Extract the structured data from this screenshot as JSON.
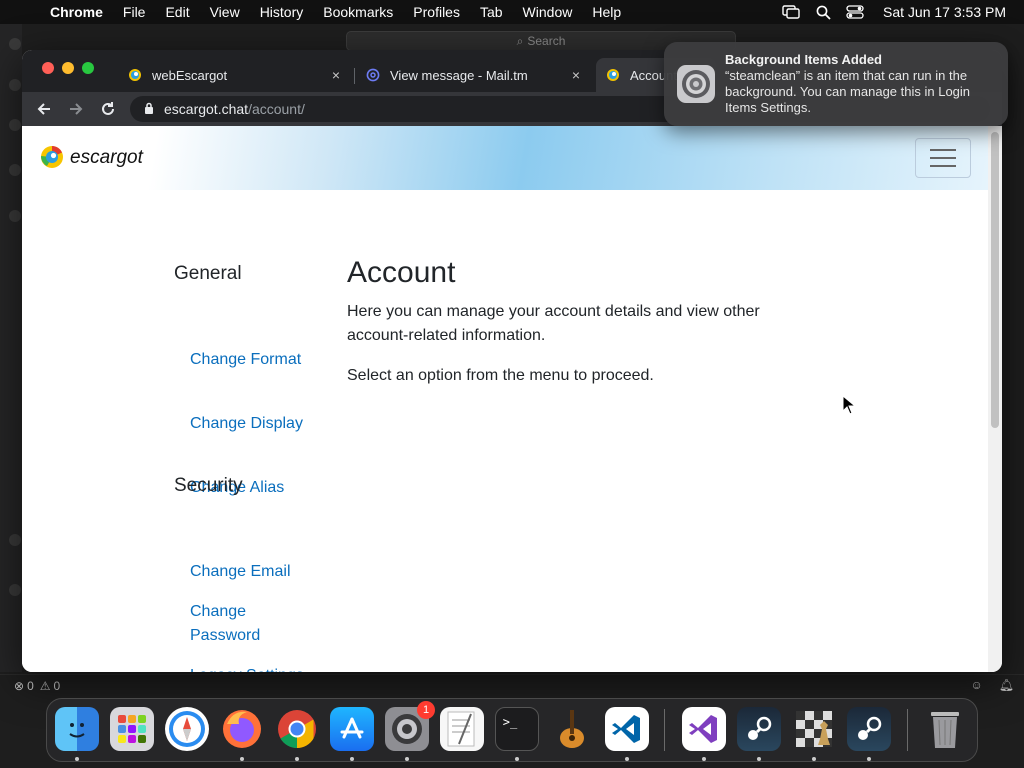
{
  "menubar": {
    "app": "Chrome",
    "items": [
      "File",
      "Edit",
      "View",
      "History",
      "Bookmarks",
      "Profiles",
      "Tab",
      "Window",
      "Help"
    ],
    "datetime": "Sat Jun 17  3:53 PM"
  },
  "background_window": {
    "search_placeholder": "Search",
    "status_errors": "0",
    "status_warnings": "0"
  },
  "chrome": {
    "tabs": [
      {
        "title": "webEscargot",
        "close": "×"
      },
      {
        "title": "View message - Mail.tm",
        "close": "×"
      },
      {
        "title": "Account"
      }
    ],
    "url": {
      "host": "escargot.chat",
      "path": "/account/"
    }
  },
  "page": {
    "brand": "escargot",
    "sidebar": {
      "general_heading": "General",
      "general_links": [
        "Change Format",
        "Change Display",
        "Change Alias"
      ],
      "security_heading": "Security",
      "security_links": [
        "Change Email",
        "Change Password",
        "Legacy Settings"
      ]
    },
    "title": "Account",
    "description": "Here you can manage your account details and view other account-related information.",
    "prompt": "Select an option from the menu to proceed."
  },
  "notification": {
    "title": "Background Items Added",
    "body": "“steamclean” is an item that can run in the background. You can manage this in Login Items Settings."
  },
  "dock": {
    "items": [
      "Finder",
      "Launchpad",
      "Safari",
      "Firefox",
      "Google Chrome",
      "App Store",
      "System Settings",
      "TextEdit",
      "Terminal",
      "GarageBand",
      "Visual Studio Code",
      "Visual Studio",
      "Steam",
      "Chess",
      "Steam",
      "Trash"
    ],
    "system_settings_badge": "1"
  },
  "colors": {
    "link": "#0a6ebd",
    "chrome_dark": "#202124",
    "chrome_tab_active": "#35363a"
  }
}
